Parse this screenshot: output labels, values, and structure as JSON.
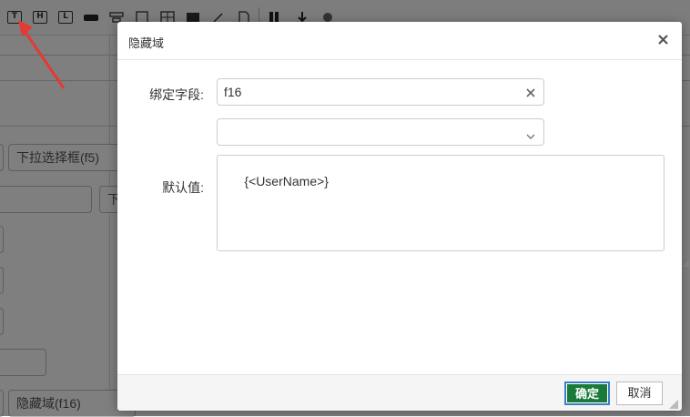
{
  "background": {
    "toolbar_icons": [
      {
        "icon": "text-box-icon",
        "label": "T"
      },
      {
        "icon": "heading-icon",
        "label": "H"
      },
      {
        "icon": "label-icon",
        "label": "L"
      },
      {
        "icon": "input-bar-icon",
        "label": ""
      },
      {
        "icon": "select-icon",
        "label": ""
      },
      {
        "icon": "checkbox-icon",
        "label": ""
      },
      {
        "icon": "table-icon",
        "label": ""
      },
      {
        "icon": "image-icon",
        "label": ""
      },
      {
        "icon": "attach-icon",
        "label": ""
      },
      {
        "icon": "file-icon",
        "label": ""
      },
      {
        "icon": "tool-icon",
        "label": ""
      },
      {
        "icon": "upload-icon",
        "label": ""
      },
      {
        "icon": "settings-icon",
        "label": ""
      }
    ],
    "fields": {
      "select_field": "下拉选择框(f5)",
      "partial_field": "下",
      "hidden_field": "隐藏域(f16)"
    }
  },
  "dialog": {
    "title": "隐藏域",
    "bind_field_label": "绑定字段:",
    "bind_field_value": "f16",
    "select_value": "",
    "default_value_label": "默认值:",
    "default_value": "{<UserName>}",
    "ok_label": "确定",
    "cancel_label": "取消"
  },
  "colors": {
    "ok_button": "#1a7a3a",
    "ok_focus_ring": "#3a7fc8",
    "arrow": "#e53935"
  }
}
